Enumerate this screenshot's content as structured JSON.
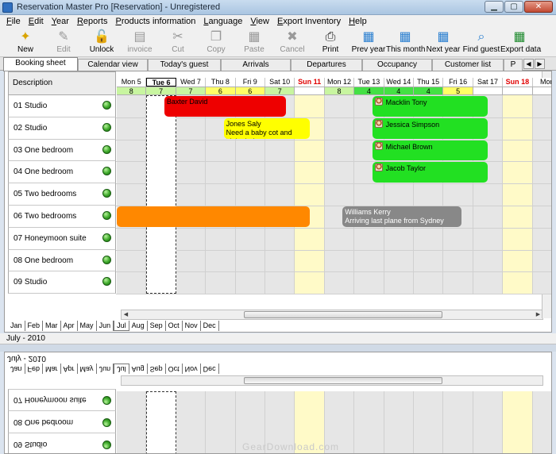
{
  "window": {
    "title": "Reservation Master Pro [Reservation] - Unregistered"
  },
  "menu": [
    {
      "label": "File",
      "accel": "F",
      "rest": "ile"
    },
    {
      "label": "Edit",
      "accel": "E",
      "rest": "dit"
    },
    {
      "label": "Year",
      "accel": "Y",
      "rest": "ear"
    },
    {
      "label": "Reports",
      "accel": "R",
      "rest": "eports"
    },
    {
      "label": "Products information",
      "accel": "P",
      "rest": "roducts information"
    },
    {
      "label": "Language",
      "accel": "L",
      "rest": "anguage"
    },
    {
      "label": "View",
      "accel": "V",
      "rest": "iew"
    },
    {
      "label": "Export Inventory",
      "accel": "E",
      "rest": "xport Inventory"
    },
    {
      "label": "Help",
      "accel": "H",
      "rest": "elp"
    }
  ],
  "toolbar": [
    {
      "label": "New",
      "icon": "new-icon",
      "glyph": "✦",
      "enabled": true,
      "color": "#d9a400"
    },
    {
      "label": "Edit",
      "icon": "edit-icon",
      "glyph": "✎",
      "enabled": false,
      "color": "#999999"
    },
    {
      "label": "Unlock",
      "icon": "unlock-icon",
      "glyph": "🔓",
      "enabled": true,
      "color": "#555555"
    },
    {
      "label": "invoice",
      "icon": "invoice-icon",
      "glyph": "▤",
      "enabled": false,
      "color": "#999999"
    },
    {
      "label": "Cut",
      "icon": "cut-icon",
      "glyph": "✂",
      "enabled": false,
      "color": "#999999"
    },
    {
      "label": "Copy",
      "icon": "copy-icon",
      "glyph": "❐",
      "enabled": false,
      "color": "#999999"
    },
    {
      "label": "Paste",
      "icon": "paste-icon",
      "glyph": "▦",
      "enabled": false,
      "color": "#999999"
    },
    {
      "label": "Cancel",
      "icon": "cancel-icon",
      "glyph": "✖",
      "enabled": false,
      "color": "#999999"
    },
    {
      "label": "Print",
      "icon": "print-icon",
      "glyph": "⎙",
      "enabled": true,
      "color": "#222222"
    },
    {
      "label": "Prev year",
      "icon": "prev-year-icon",
      "glyph": "▦",
      "enabled": true,
      "color": "#2a7fd0"
    },
    {
      "label": "This month",
      "icon": "this-month-icon",
      "glyph": "▦",
      "enabled": true,
      "color": "#2a7fd0"
    },
    {
      "label": "Next year",
      "icon": "next-year-icon",
      "glyph": "▦",
      "enabled": true,
      "color": "#2a7fd0"
    },
    {
      "label": "Find guest",
      "icon": "find-guest-icon",
      "glyph": "⌕",
      "enabled": true,
      "color": "#2a7fd0"
    },
    {
      "label": "Export data",
      "icon": "export-data-icon",
      "glyph": "▦",
      "enabled": true,
      "color": "#1e8a2e"
    }
  ],
  "tabs": [
    {
      "label": "Booking sheet",
      "active": true
    },
    {
      "label": "Calendar view",
      "active": false
    },
    {
      "label": "Today's guest",
      "active": false
    },
    {
      "label": "Arrivals",
      "active": false
    },
    {
      "label": "Departures",
      "active": false
    },
    {
      "label": "Occupancy",
      "active": false
    },
    {
      "label": "Customer list",
      "active": false
    },
    {
      "label": "P",
      "active": false
    }
  ],
  "grid": {
    "description_header": "Description",
    "days": [
      {
        "label": "Mon 5",
        "count": "8",
        "count_color": "#c8f5a0",
        "type": "weekday"
      },
      {
        "label": "Tue 6",
        "count": "7",
        "count_color": "#c8f5a0",
        "type": "today"
      },
      {
        "label": "Wed 7",
        "count": "7",
        "count_color": "#c8f5a0",
        "type": "weekday"
      },
      {
        "label": "Thu 8",
        "count": "6",
        "count_color": "#ffff66",
        "type": "weekday"
      },
      {
        "label": "Fri 9",
        "count": "6",
        "count_color": "#ffff66",
        "type": "weekday"
      },
      {
        "label": "Sat 10",
        "count": "7",
        "count_color": "#c8f5a0",
        "type": "weekday"
      },
      {
        "label": "Sun 11",
        "count": "",
        "count_color": "#ffffff",
        "type": "sunday"
      },
      {
        "label": "Mon 12",
        "count": "8",
        "count_color": "#c8f5a0",
        "type": "weekday"
      },
      {
        "label": "Tue 13",
        "count": "4",
        "count_color": "#44e044",
        "type": "weekday"
      },
      {
        "label": "Wed 14",
        "count": "4",
        "count_color": "#44e044",
        "type": "weekday"
      },
      {
        "label": "Thu 15",
        "count": "4",
        "count_color": "#44e044",
        "type": "weekday"
      },
      {
        "label": "Fri 16",
        "count": "5",
        "count_color": "#ffff66",
        "type": "weekday"
      },
      {
        "label": "Sat 17",
        "count": "",
        "count_color": "#ffffff",
        "type": "weekday"
      },
      {
        "label": "Sun 18",
        "count": "",
        "count_color": "#ffffff",
        "type": "sunday"
      },
      {
        "label": "Mon",
        "count": "",
        "count_color": "#ffffff",
        "type": "weekday"
      }
    ],
    "rooms": [
      {
        "name": "01 Studio"
      },
      {
        "name": "02 Studio"
      },
      {
        "name": "03 One bedroom"
      },
      {
        "name": "04 One bedroom"
      },
      {
        "name": "05 Two bedrooms"
      },
      {
        "name": "06 Two bedrooms"
      },
      {
        "name": "07 Honeymoon suite"
      },
      {
        "name": "08 One bedroom"
      },
      {
        "name": "09 Studio"
      }
    ],
    "bookings": [
      {
        "room": 0,
        "start": 1.6,
        "end": 5.7,
        "line1": "Baxter David",
        "line2": "",
        "color": "#ee0000",
        "icon": false
      },
      {
        "room": 1,
        "start": 3.6,
        "end": 6.5,
        "line1": "Jones Saly",
        "line2": "Need a baby cot and high chair",
        "color": "#ffff00",
        "icon": false
      },
      {
        "room": 0,
        "start": 8.6,
        "end": 12.5,
        "line1": "Macklin Tony",
        "line2": "",
        "color": "#22e022",
        "icon": true
      },
      {
        "room": 1,
        "start": 8.6,
        "end": 12.5,
        "line1": "Jessica Simpson",
        "line2": "",
        "color": "#22e022",
        "icon": true
      },
      {
        "room": 2,
        "start": 8.6,
        "end": 12.5,
        "line1": "Michael Brown",
        "line2": "",
        "color": "#22e022",
        "icon": true
      },
      {
        "room": 3,
        "start": 8.6,
        "end": 12.5,
        "line1": "Jacob Taylor",
        "line2": "",
        "color": "#22e022",
        "icon": true
      },
      {
        "room": 5,
        "start": 0,
        "end": 6.5,
        "line1": "",
        "line2": "",
        "color": "#ff8800",
        "icon": false
      },
      {
        "room": 5,
        "start": 7.6,
        "end": 11.6,
        "line1": "Williams Kerry",
        "line2": "Arriving last plane from Sydney",
        "color": "#888888",
        "icon": false
      }
    ],
    "months": [
      "Jan",
      "Feb",
      "Mar",
      "Apr",
      "May",
      "Jun",
      "Jul",
      "Aug",
      "Sep",
      "Oct",
      "Nov",
      "Dec"
    ],
    "active_month": "Jul"
  },
  "status": {
    "month_label": "July - 2010"
  },
  "lower_panel": {
    "rooms": [
      "09 Studio",
      "08 One bedroom",
      "07 Honeymoon suite"
    ]
  },
  "watermark": "GearDownload.com"
}
